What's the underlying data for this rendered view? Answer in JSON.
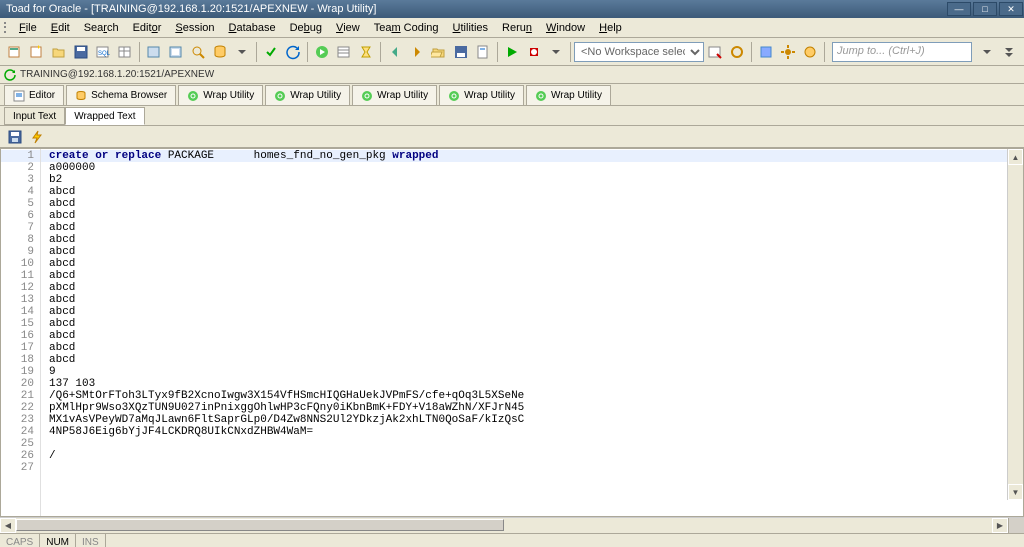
{
  "window": {
    "title": "Toad for Oracle - [TRAINING@192.168.1.20:1521/APEXNEW - Wrap Utility]"
  },
  "menu": {
    "items": [
      {
        "u": "F",
        "rest": "ile"
      },
      {
        "u": "E",
        "rest": "dit"
      },
      {
        "u": "",
        "rest": "Sea",
        "u2": "r",
        "rest2": "ch"
      },
      {
        "u": "",
        "rest": "Edit",
        "u2": "o",
        "rest2": "r"
      },
      {
        "u": "S",
        "rest": "ession"
      },
      {
        "u": "D",
        "rest": "atabase"
      },
      {
        "u": "",
        "rest": "De",
        "u2": "b",
        "rest2": "ug"
      },
      {
        "u": "V",
        "rest": "iew"
      },
      {
        "u": "",
        "rest": "Tea",
        "u2": "m",
        "rest2": " Coding"
      },
      {
        "u": "U",
        "rest": "tilities"
      },
      {
        "u": "",
        "rest": "Reru",
        "u2": "n",
        "rest2": ""
      },
      {
        "u": "W",
        "rest": "indow"
      },
      {
        "u": "H",
        "rest": "elp"
      }
    ]
  },
  "toolbar": {
    "workspace_combo": "<No Workspace selected>",
    "jump_placeholder": "Jump to... (Ctrl+J)"
  },
  "connection": {
    "label": "TRAINING@192.168.1.20:1521/APEXNEW"
  },
  "doctabs": [
    {
      "label": "Editor",
      "icon": "editor"
    },
    {
      "label": "Schema Browser",
      "icon": "schema"
    },
    {
      "label": "Wrap Utility",
      "icon": "wrap"
    },
    {
      "label": "Wrap Utility",
      "icon": "wrap"
    },
    {
      "label": "Wrap Utility",
      "icon": "wrap"
    },
    {
      "label": "Wrap Utility",
      "icon": "wrap"
    },
    {
      "label": "Wrap Utility",
      "icon": "wrap"
    }
  ],
  "subtabs": {
    "input": "Input Text",
    "wrapped": "Wrapped Text"
  },
  "code": {
    "lines": [
      {
        "n": 1,
        "sel": true,
        "raw": "create or replace PACKAGE      homes_fnd_no_gen_pkg wrapped",
        "kw": true
      },
      {
        "n": 2,
        "raw": "a000000"
      },
      {
        "n": 3,
        "raw": "b2"
      },
      {
        "n": 4,
        "raw": "abcd"
      },
      {
        "n": 5,
        "raw": "abcd"
      },
      {
        "n": 6,
        "raw": "abcd"
      },
      {
        "n": 7,
        "raw": "abcd"
      },
      {
        "n": 8,
        "raw": "abcd"
      },
      {
        "n": 9,
        "raw": "abcd"
      },
      {
        "n": 10,
        "raw": "abcd"
      },
      {
        "n": 11,
        "raw": "abcd"
      },
      {
        "n": 12,
        "raw": "abcd"
      },
      {
        "n": 13,
        "raw": "abcd"
      },
      {
        "n": 14,
        "raw": "abcd"
      },
      {
        "n": 15,
        "raw": "abcd"
      },
      {
        "n": 16,
        "raw": "abcd"
      },
      {
        "n": 17,
        "raw": "abcd"
      },
      {
        "n": 18,
        "raw": "abcd"
      },
      {
        "n": 19,
        "raw": "9"
      },
      {
        "n": 20,
        "raw": "137 103"
      },
      {
        "n": 21,
        "raw": "/Q6+SMtOrFToh3LTyx9fB2XcnoIwgw3X154VfHSmcHIQGHaUekJVPmFS/cfe+qOq3L5XSeNe"
      },
      {
        "n": 22,
        "raw": "pXMlHpr9Wso3XQzTUN9U027inPnixggOhlwHP3cFQny0iKbnBmK+FDY+V18aWZhN/XFJrN45"
      },
      {
        "n": 23,
        "raw": "MX1vAsVPeyWD7aMqJLawn6FltSaprGLp0/D4Zw8NNS2Ul2YDkzjAk2xhLTN0QoSaF/kIzQsC"
      },
      {
        "n": 24,
        "raw": "4NP58J6Eig6bYjJF4LCKDRQ8UIkCNxdZHBW4WaM="
      },
      {
        "n": 25,
        "raw": ""
      },
      {
        "n": 26,
        "raw": "/"
      },
      {
        "n": 27,
        "raw": ""
      }
    ]
  },
  "status": {
    "caps": "CAPS",
    "num": "NUM",
    "ins": "INS"
  }
}
